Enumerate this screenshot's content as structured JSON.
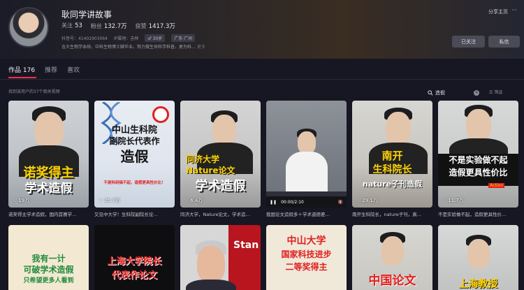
{
  "profile": {
    "name": "耿同学讲故事",
    "stats": [
      {
        "label": "关注",
        "value": "53"
      },
      {
        "label": "粉丝",
        "value": "132.7万"
      },
      {
        "label": "获赞",
        "value": "1417.3万"
      }
    ],
    "douyin_id": "抖音号：41402903064",
    "ip": "IP属地：吉林",
    "tags": [
      "♂ 30岁",
      "广东·广州"
    ],
    "bio": "吉大生物学本硕，中科生物博士肄毕业。努力做生命科学科普，更为科…",
    "bio_more": "更多",
    "share_label": "分享主页",
    "more_label": "···",
    "followed_label": "已关注",
    "message_label": "私信"
  },
  "tabs": [
    {
      "label": "作品 176",
      "active": true
    },
    {
      "label": "推荐",
      "active": false
    },
    {
      "label": "喜欢",
      "active": false
    }
  ],
  "found_text": "找到该用户的37个相关视频",
  "search": {
    "value": "造假",
    "filter_label": "筛选"
  },
  "videos_row1": [
    {
      "title1": "诺奖得主",
      "title2": "学术造假",
      "likes": "19万",
      "caption": "诺奖得主学术造假，国内首赛学…"
    },
    {
      "title1": "中山生科院",
      "title2": "副院长代表作",
      "title3": "造假",
      "sub": "不是科研搞不起，造假更具性价比！",
      "likes": "25.7万",
      "caption": "又见中大学！生科院副院长论…"
    },
    {
      "title1": "同济大学",
      "title2": "Nature论文",
      "title3": "学术造假",
      "likes": "6.4万",
      "caption": "同济大学，Nature论文，学术造…"
    },
    {
      "time": "00:00/2:10",
      "caption": "我国论文造假多＋学术道德差…"
    },
    {
      "title1": "南开",
      "title2": "生科院长",
      "title3": "nature子刊造假",
      "likes": "29.1万",
      "caption": "南开生科院长，nature子刊，真…"
    },
    {
      "title1": "不是实验做不起",
      "title2": "造假更具性价比",
      "badge": "Action",
      "likes": "11.7万",
      "caption": "不是实验做不起，造假更具性价…"
    }
  ],
  "videos_row2": [
    {
      "title1": "我有一计",
      "title2": "可破学术造假",
      "title3": "只希望更多人看到"
    },
    {
      "title1": "上海大学院长",
      "title2": "代表作论文"
    },
    {
      "title1": "Stan"
    },
    {
      "title1": "中山大学",
      "title2": "国家科技进步",
      "title3": "二等奖得主"
    },
    {
      "title1": "中国论文"
    },
    {
      "title1": "上海教授"
    }
  ],
  "colors": {
    "accent": "#fe2c55",
    "background": "#161722"
  }
}
